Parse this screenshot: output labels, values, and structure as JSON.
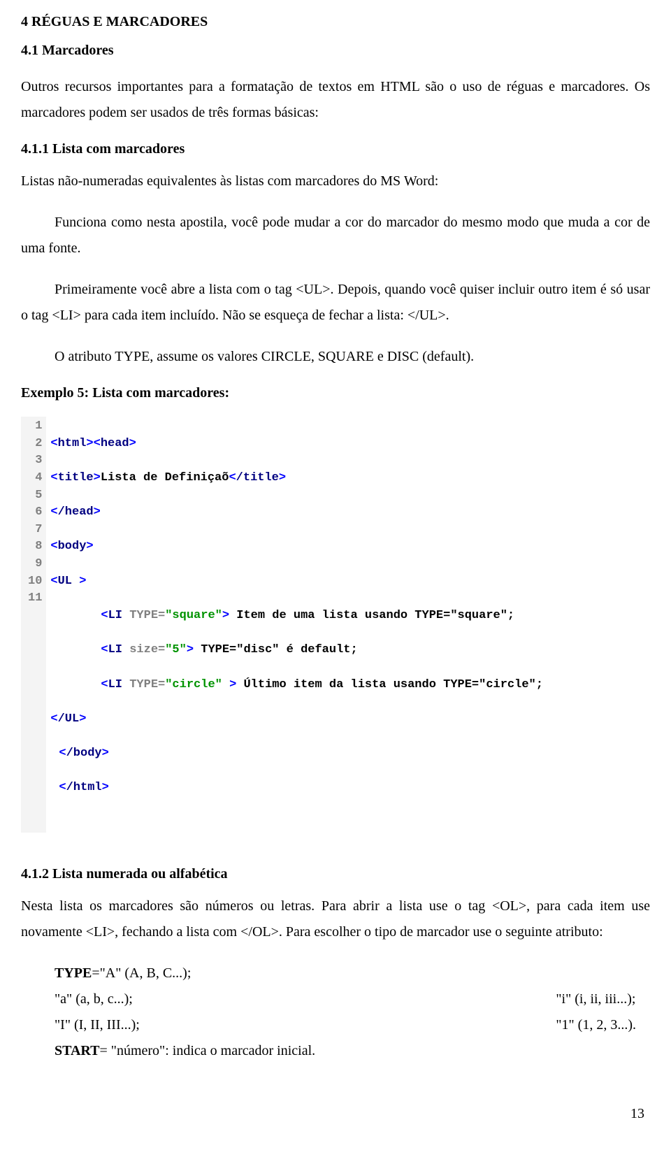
{
  "sec": {
    "h_main": "4 RÉGUAS E MARCADORES",
    "h_sub1": "4.1 Marcadores",
    "p_intro": "Outros recursos importantes para a formatação de textos em HTML são o uso de réguas e marcadores. Os marcadores podem ser usados de três formas básicas:",
    "h_411": "4.1.1 Lista com marcadores",
    "p_411a": "Listas não-numeradas equivalentes às listas com marcadores do MS Word:",
    "p_411b": "Funciona como nesta apostila, você  pode mudar a cor do marcador do mesmo modo que muda a cor de uma fonte.",
    "p_411c": "Primeiramente você abre a lista com o tag <UL>. Depois, quando você quiser incluir outro item é só usar o tag <LI> para cada item incluído. Não se esqueça de fechar a lista: </UL>.",
    "p_411d": "O atributo TYPE, assume os valores CIRCLE, SQUARE e DISC (default).",
    "example_label": "Exemplo 5: Lista com marcadores:",
    "h_412": "4.1.2 Lista numerada ou alfabética",
    "p_412a": "Nesta lista os marcadores são números ou letras. Para abrir a lista use o tag <OL>, para cada item use novamente <LI>, fechando a lista com </OL>. Para escolher o tipo de marcador use o seguinte atributo:",
    "attr_typeA": "TYPE=\"A\" (A, B, C...);",
    "attr_a": "\"a\" (a, b, c...);",
    "attr_I": "\"I\" (I, II, III...);",
    "attr_i": "\"i\" (i, ii, iii...);",
    "attr_1": "\"1\" (1, 2, 3...).",
    "attr_start": "START= \"número\": indica o marcador inicial.",
    "pagenum": "13"
  },
  "code": {
    "lines": [
      {
        "n": "1"
      },
      {
        "n": "2"
      },
      {
        "n": "3"
      },
      {
        "n": "4"
      },
      {
        "n": "5"
      },
      {
        "n": "6"
      },
      {
        "n": "7"
      },
      {
        "n": "8"
      },
      {
        "n": "9"
      },
      {
        "n": "10"
      },
      {
        "n": "11"
      }
    ],
    "l1_html": "html",
    "l1_head": "head",
    "l2_title_open": "title",
    "l2_text": "Lista de Definiçaõ",
    "l2_title_close": "/title",
    "l3_head_close": "/head",
    "l4_body": "body",
    "l5_ul": "UL ",
    "l6_li": "LI",
    "l6_attr": " TYPE=",
    "l6_str": "\"square\"",
    "l6_txt": " Item de uma lista usando TYPE=\"square\";",
    "l7_li": "LI",
    "l7_attr": " size=",
    "l7_str": "\"5\"",
    "l7_txt_a": " TYPE=\"disc\" é ",
    "l7_bold": "default",
    "l7_txt_b": ";",
    "l8_li": "LI",
    "l8_attr": " TYPE=",
    "l8_str": "\"circle\" ",
    "l8_txt": " Último item da lista usando TYPE=\"circle\";",
    "l9_ul_close": "/UL",
    "l10_body_close": "/body",
    "l11_html_close": "/html"
  }
}
